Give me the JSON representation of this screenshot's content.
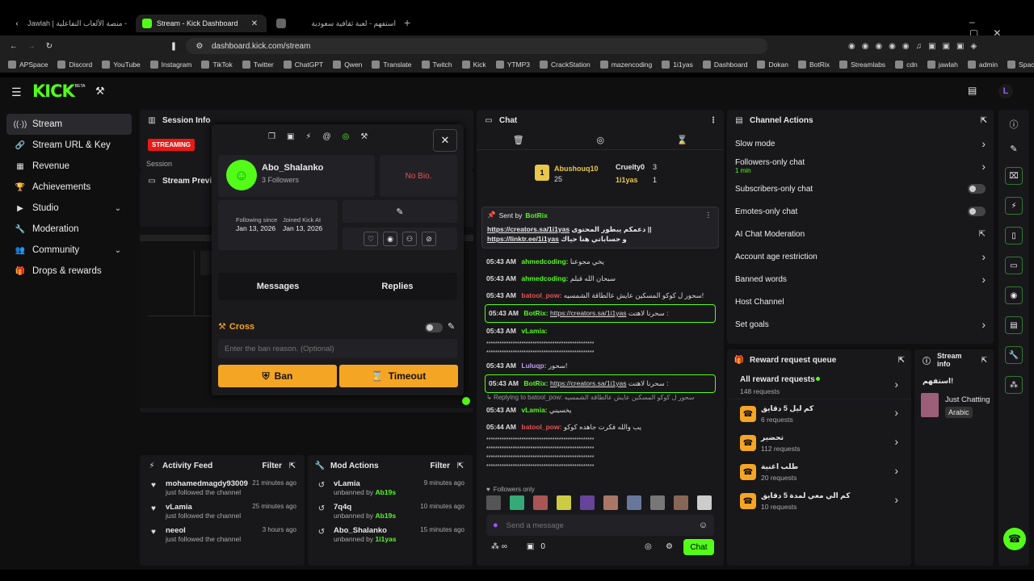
{
  "browser": {
    "tabs": [
      {
        "title": "Jawlah | جولة - منصة الألعاب التفاعلية"
      },
      {
        "title": "Stream - Kick Dashboard"
      },
      {
        "title": "استفهم - لعبة ثقافية سعودية"
      }
    ],
    "url": "dashboard.kick.com/stream",
    "bookmarks": [
      "APSpace",
      "Discord",
      "YouTube",
      "Instagram",
      "TikTok",
      "Twitter",
      "ChatGPT",
      "Qwen",
      "Translate",
      "Twitch",
      "Kick",
      "YTMP3",
      "CrackStation",
      "mazencoding",
      "1i1yas",
      "Dashboard",
      "Dokan",
      "BotRix",
      "Streamlabs",
      "cdn",
      "jawlah",
      "admin",
      "Spacemail"
    ]
  },
  "brand": {
    "logo": "KICK",
    "beta": "BETA"
  },
  "sidebar": {
    "items": [
      {
        "label": "Stream"
      },
      {
        "label": "Stream URL & Key"
      },
      {
        "label": "Revenue"
      },
      {
        "label": "Achievements"
      },
      {
        "label": "Studio"
      },
      {
        "label": "Moderation"
      },
      {
        "label": "Community"
      },
      {
        "label": "Drops & rewards"
      }
    ]
  },
  "session": {
    "title": "Session Info",
    "status": "STREAMING",
    "session_label": "Session",
    "preview_title": "Stream Preview"
  },
  "user_card": {
    "username": "Abo_Shalanko",
    "followers": "3 Followers",
    "bio": "No Bio.",
    "following_since_label": "Following since",
    "following_since": "Jan 13, 2026",
    "joined_label": "Joined Kick At",
    "joined": "Jan 13, 2026",
    "tab_messages": "Messages",
    "tab_replies": "Replies",
    "action_title": "Cross",
    "ban_reason_placeholder": "Enter the ban reason. (Optional)",
    "ban": "Ban",
    "timeout": "Timeout"
  },
  "activity": {
    "title": "Activity Feed",
    "filter": "Filter",
    "items": [
      {
        "name": "mohamedmagdy93009",
        "time": "21 minutes ago",
        "sub": "just followed the channel"
      },
      {
        "name": "vLamia",
        "time": "25 minutes ago",
        "sub": "just followed the channel"
      },
      {
        "name": "neeol",
        "time": "3 hours ago",
        "sub": "just followed the channel"
      }
    ]
  },
  "modactions": {
    "title": "Mod Actions",
    "filter": "Filter",
    "items": [
      {
        "name": "vLamia",
        "time": "9 minutes ago",
        "sub": "unbanned by",
        "by": "Ab19s"
      },
      {
        "name": "7q4q",
        "time": "10 minutes ago",
        "sub": "unbanned by",
        "by": "Ab19s"
      },
      {
        "name": "Abo_Shalanko",
        "time": "15 minutes ago",
        "sub": "unbanned by",
        "by": "1i1yas"
      }
    ]
  },
  "chat": {
    "title": "Chat",
    "leaders": [
      {
        "name": "Abushouq10",
        "count": "25"
      },
      {
        "name": "Cruelty0",
        "count": "3"
      },
      {
        "name": "1i1yas",
        "count": "1"
      }
    ],
    "pinned": {
      "sent_by": "Sent by",
      "bot": "BotRix",
      "line1": "https://creators.sa/1i1yas",
      "line1b": "دعمكم يبطور المحتوى || ",
      "line2": "https://linktr.ee/1i1yas",
      "line2b": "و حساباتي هنا حياك"
    },
    "messages": [
      {
        "ts": "05:43 AM",
        "user": "ahmedcoding:",
        "text": "يخي مجوعنا"
      },
      {
        "ts": "05:43 AM",
        "user": "ahmedcoding:",
        "text": "سبحان الله قبلم"
      },
      {
        "ts": "05:43 AM",
        "user": "batool_pow:",
        "text": "سحور ل كوكو المسكين عايش عالطاقة الشمسيه!"
      },
      {
        "ts": "05:43 AM",
        "user": "BotRix:",
        "link": "https://creators.sa/1i1yas",
        "text": "سحرنا لاهتت :"
      },
      {
        "ts": "05:43 AM",
        "user": "vLamia:",
        "text": ""
      },
      {
        "ts": "05:43 AM",
        "user": "Luluqp:",
        "text": "سحور!"
      },
      {
        "ts": "05:43 AM",
        "user": "BotRix:",
        "link": "https://creators.sa/1i1yas",
        "text": "سحرنا لاهتت :"
      },
      {
        "ts": "05:43 AM",
        "user": "vLamia:",
        "text": "يخسيني"
      },
      {
        "ts": "05:44 AM",
        "user": "batool_pow:",
        "text": "يب والله فكرت جاهده كوكو"
      }
    ],
    "stars": "*************************************************",
    "reply_to": "Replying to batool_pow:",
    "reply_text": "سحور ل كوكو المسكين عايش عالطاقة الشمسيه",
    "followers_only": "Followers only",
    "input_placeholder": "Send a message",
    "count": "0",
    "send": "Chat"
  },
  "channel_actions": {
    "title": "Channel Actions",
    "items": [
      {
        "label": "Slow mode"
      },
      {
        "label": "Followers-only chat",
        "sub": "1 min"
      },
      {
        "label": "Subscribers-only chat"
      },
      {
        "label": "Emotes-only chat"
      },
      {
        "label": "AI Chat Moderation"
      },
      {
        "label": "Account age restriction"
      },
      {
        "label": "Banned words"
      },
      {
        "label": "Host Channel"
      },
      {
        "label": "Set goals"
      }
    ]
  },
  "rewards": {
    "title": "Reward request queue",
    "all": "All reward requests",
    "all_count": "148 requests",
    "items": [
      {
        "name": "كم ليل 5 دقايق",
        "count": "6 requests"
      },
      {
        "name": "تحضير",
        "count": "112 requests"
      },
      {
        "name": "طلب اغنية",
        "count": "20 requests"
      },
      {
        "name": "كم الي معي لمدة 5 دقايق",
        "count": "10 requests"
      }
    ]
  },
  "stream_info": {
    "title": "Stream info",
    "game": "استفهم!",
    "status": "Just Chatting",
    "tag": "Arabic"
  }
}
